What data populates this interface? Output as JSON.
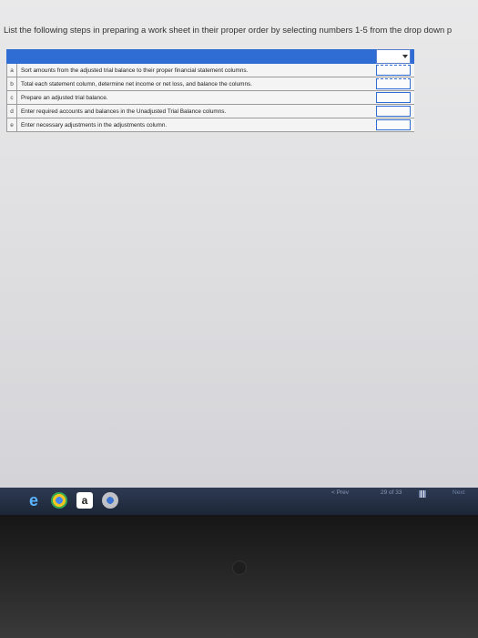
{
  "instruction": "List the following steps in preparing a work sheet in their proper order by selecting numbers 1-5 from the drop down p",
  "steps": [
    {
      "letter": "a",
      "text": "Sort amounts from the adjusted trial balance to their proper financial statement columns."
    },
    {
      "letter": "b",
      "text": "Total each statement column, determine net income or net loss, and balance the columns."
    },
    {
      "letter": "c",
      "text": "Prepare an adjusted trial balance."
    },
    {
      "letter": "d",
      "text": "Enter required accounts and balances in the Unadjusted Trial Balance columns."
    },
    {
      "letter": "e",
      "text": "Enter necessary adjustments in the adjustments column."
    }
  ],
  "nav": {
    "prev": "< Prev",
    "pages": "29  of  33",
    "next": "Next"
  },
  "taskbar": {
    "icons": [
      "ie-icon",
      "chrome-icon",
      "amazon-icon",
      "chrome-icon"
    ]
  },
  "colors": {
    "header_blue": "#2f6cd4",
    "taskbar": "#1d2638"
  }
}
